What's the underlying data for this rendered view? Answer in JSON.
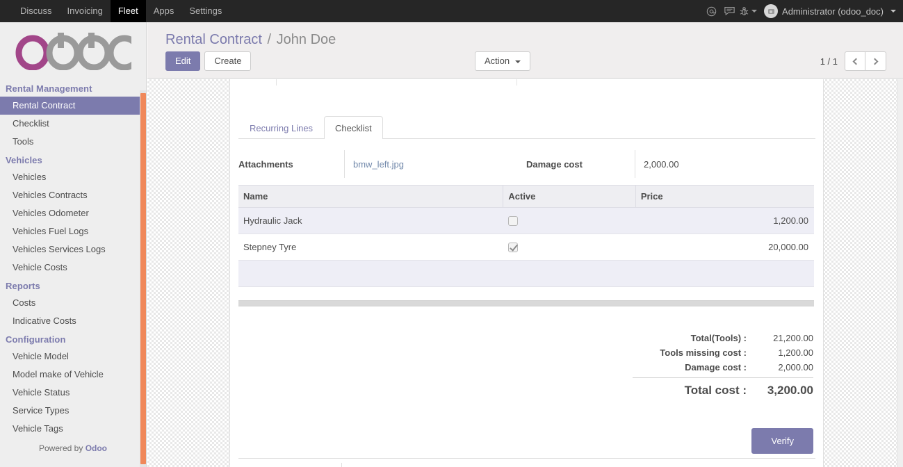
{
  "topbar": {
    "menus": [
      {
        "label": "Discuss",
        "active": false
      },
      {
        "label": "Invoicing",
        "active": false
      },
      {
        "label": "Fleet",
        "active": true
      },
      {
        "label": "Apps",
        "active": false
      },
      {
        "label": "Settings",
        "active": false
      }
    ],
    "icons": {
      "mention": "at-icon",
      "messages": "speech-bubble-icon",
      "debug": "bug-icon"
    },
    "user_label": "Administrator (odoo_doc)"
  },
  "sidebar": {
    "logo_text": "odoo",
    "sections": [
      {
        "title": "Rental Management",
        "items": [
          {
            "label": "Rental Contract",
            "active": true
          },
          {
            "label": "Checklist",
            "active": false
          },
          {
            "label": "Tools",
            "active": false
          }
        ]
      },
      {
        "title": "Vehicles",
        "items": [
          {
            "label": "Vehicles",
            "active": false
          },
          {
            "label": "Vehicles Contracts",
            "active": false
          },
          {
            "label": "Vehicles Odometer",
            "active": false
          },
          {
            "label": "Vehicles Fuel Logs",
            "active": false
          },
          {
            "label": "Vehicles Services Logs",
            "active": false
          },
          {
            "label": "Vehicle Costs",
            "active": false
          }
        ]
      },
      {
        "title": "Reports",
        "items": [
          {
            "label": "Costs",
            "active": false
          },
          {
            "label": "Indicative Costs",
            "active": false
          }
        ]
      },
      {
        "title": "Configuration",
        "items": [
          {
            "label": "Vehicle Model",
            "active": false
          },
          {
            "label": "Model make of Vehicle",
            "active": false
          },
          {
            "label": "Vehicle Status",
            "active": false
          },
          {
            "label": "Service Types",
            "active": false
          },
          {
            "label": "Vehicle Tags",
            "active": false
          }
        ]
      }
    ],
    "powered_prefix": "Powered by ",
    "powered_brand": "Odoo"
  },
  "control_panel": {
    "breadcrumb_root": "Rental Contract",
    "breadcrumb_sep": "/",
    "breadcrumb_current": "John Doe",
    "edit_label": "Edit",
    "create_label": "Create",
    "action_label": "Action",
    "pager_label": "1 / 1"
  },
  "form": {
    "tabs": [
      {
        "label": "Recurring Lines",
        "active": false
      },
      {
        "label": "Checklist",
        "active": true
      }
    ],
    "attachments_label": "Attachments",
    "attachment_value": "bmw_left.jpg",
    "damage_cost_label": "Damage cost",
    "damage_cost_value": "2,000.00"
  },
  "table": {
    "columns": [
      "Name",
      "Active",
      "Price"
    ],
    "rows": [
      {
        "name": "Hydraulic Jack",
        "active": false,
        "price": "1,200.00"
      },
      {
        "name": "Stepney Tyre",
        "active": true,
        "price": "20,000.00"
      }
    ]
  },
  "totals": [
    {
      "label": "Total(Tools) :",
      "value": "21,200.00",
      "grand": false
    },
    {
      "label": "Tools missing cost :",
      "value": "1,200.00",
      "grand": false
    },
    {
      "label": "Damage cost :",
      "value": "2,000.00",
      "grand": false
    },
    {
      "label": "Total cost :",
      "value": "3,200.00",
      "grand": true
    }
  ],
  "actions": {
    "verify_label": "Verify"
  },
  "colors": {
    "odoo_purple": "#7c7bad",
    "odoo_magenta": "#a24689",
    "logo_gray": "#9a9a9a",
    "navbar_dark": "#262626",
    "sidebar_scroll_orange": "#f0885a",
    "row_alt": "#eeeef6"
  }
}
